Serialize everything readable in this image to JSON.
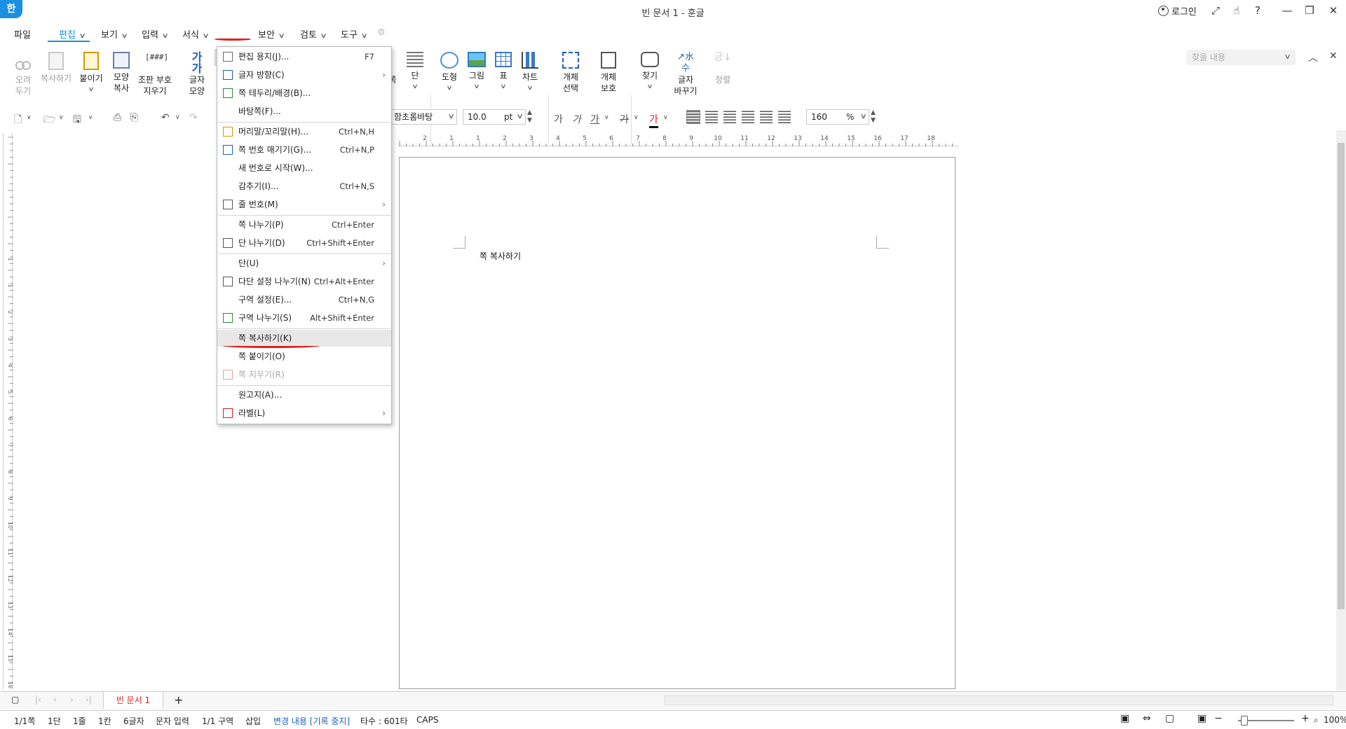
{
  "titlebar": {
    "app_logo": "한",
    "title": "빈 문서 1 - 훈글",
    "login": "로그인",
    "buttons": [
      "⤢",
      "☝",
      "?",
      "—",
      "❐",
      "✕"
    ]
  },
  "menubar": {
    "items": [
      {
        "label": "파일",
        "chev": ""
      },
      {
        "label": "편집",
        "chev": "∨"
      },
      {
        "label": "보기",
        "chev": "∨"
      },
      {
        "label": "입력",
        "chev": "∨"
      },
      {
        "label": "서식",
        "chev": "∨"
      },
      {
        "label": "쪽",
        "chev": "∨"
      },
      {
        "label": "보안",
        "chev": "∨"
      },
      {
        "label": "검토",
        "chev": "∨"
      },
      {
        "label": "도구",
        "chev": "∨"
      }
    ],
    "search_placeholder": "찾을 내용",
    "ribbon_collapse": "︿",
    "ribbon_close": "✕"
  },
  "ribbon": {
    "cut": [
      "오려",
      "두기"
    ],
    "copy": "복사하기",
    "paste": "붙이기",
    "format_copy": [
      "모양",
      "복사"
    ],
    "clear_code": [
      "조판 부호",
      "지우기"
    ],
    "clear_code_icon": "[###]",
    "char_shape": [
      "글자",
      "모양"
    ],
    "char_shape_icon": "가가",
    "col_hidden": "쪽",
    "column": "단",
    "shape": "도형",
    "image": "그림",
    "table": "표",
    "chart": "차트",
    "select_obj": [
      "개체",
      "선택"
    ],
    "protect_obj": [
      "개체",
      "보호"
    ],
    "find": "찾기",
    "replace": [
      "글자",
      "바꾸기"
    ],
    "replace_icon": "↗水 수",
    "sort": "정렬",
    "sort_icon": "긍↓",
    "chev": "∨"
  },
  "format": {
    "font_name": "함초롬바탕",
    "font_size": "10.0",
    "font_unit": "pt",
    "bold": "가",
    "italic": "가",
    "underline": "가",
    "strike": "가",
    "color": "가",
    "line_spacing": "160",
    "line_unit": "%",
    "dd": "∨"
  },
  "ruler_numbers": [
    "2",
    "1",
    "1",
    "2",
    "3",
    "4",
    "5",
    "6",
    "7",
    "8",
    "9",
    "10",
    "11",
    "12",
    "13",
    "14",
    "15",
    "16",
    "17",
    "18"
  ],
  "vruler_numbers": [
    "1",
    "1",
    "2",
    "3",
    "4",
    "5",
    "6",
    "7",
    "8",
    "9",
    "10",
    "11",
    "12",
    "13",
    "14",
    "15",
    "16"
  ],
  "page": {
    "body_text": "쪽 복사하기"
  },
  "dropdown": {
    "items": [
      {
        "label": "편집 용지(J)...",
        "shortcut": "F7",
        "arrow": "",
        "icon": "page-setup-icon",
        "disabled": false,
        "highlight": false
      },
      {
        "label": "글자 방향(C)",
        "shortcut": "",
        "arrow": "›",
        "icon": "text-direction-icon",
        "disabled": false,
        "highlight": false
      },
      {
        "label": "쪽 테두리/배경(B)...",
        "shortcut": "",
        "arrow": "",
        "icon": "page-border-icon",
        "disabled": false,
        "highlight": false
      },
      {
        "label": "바탕쪽(F)...",
        "shortcut": "",
        "arrow": "",
        "icon": "",
        "disabled": false,
        "highlight": false
      },
      {
        "label": "머리말/꼬리말(H)...",
        "shortcut": "Ctrl+N,H",
        "arrow": "",
        "icon": "header-footer-icon",
        "disabled": false,
        "highlight": false
      },
      {
        "label": "쪽 번호 매기기(G)...",
        "shortcut": "Ctrl+N,P",
        "arrow": "",
        "icon": "page-number-icon",
        "disabled": false,
        "highlight": false
      },
      {
        "label": "새 번호로 시작(W)...",
        "shortcut": "",
        "arrow": "",
        "icon": "",
        "disabled": false,
        "highlight": false
      },
      {
        "label": "감추기(I)...",
        "shortcut": "Ctrl+N,S",
        "arrow": "",
        "icon": "",
        "disabled": false,
        "highlight": false
      },
      {
        "label": "줄 번호(M)",
        "shortcut": "",
        "arrow": "›",
        "icon": "line-number-icon",
        "disabled": false,
        "highlight": false
      },
      {
        "label": "쪽 나누기(P)",
        "shortcut": "Ctrl+Enter",
        "arrow": "",
        "icon": "",
        "disabled": false,
        "highlight": false
      },
      {
        "label": "단 나누기(D)",
        "shortcut": "Ctrl+Shift+Enter",
        "arrow": "",
        "icon": "column-break-icon",
        "disabled": false,
        "highlight": false
      },
      {
        "label": "단(U)",
        "shortcut": "",
        "arrow": "›",
        "icon": "",
        "disabled": false,
        "highlight": false
      },
      {
        "label": "다단 설정 나누기(N)",
        "shortcut": "Ctrl+Alt+Enter",
        "arrow": "",
        "icon": "multi-column-icon",
        "disabled": false,
        "highlight": false
      },
      {
        "label": "구역 설정(E)...",
        "shortcut": "Ctrl+N,G",
        "arrow": "",
        "icon": "",
        "disabled": false,
        "highlight": false
      },
      {
        "label": "구역 나누기(S)",
        "shortcut": "Alt+Shift+Enter",
        "arrow": "",
        "icon": "section-break-icon",
        "disabled": false,
        "highlight": false
      },
      {
        "label": "쪽 복사하기(K)",
        "shortcut": "",
        "arrow": "",
        "icon": "",
        "disabled": false,
        "highlight": true
      },
      {
        "label": "쪽 붙이기(O)",
        "shortcut": "",
        "arrow": "",
        "icon": "",
        "disabled": false,
        "highlight": false
      },
      {
        "label": "쪽 지우기(R)",
        "shortcut": "",
        "arrow": "",
        "icon": "delete-page-icon",
        "disabled": true,
        "highlight": false
      },
      {
        "label": "원고지(A)...",
        "shortcut": "",
        "arrow": "",
        "icon": "",
        "disabled": false,
        "highlight": false
      },
      {
        "label": "라벨(L)",
        "shortcut": "",
        "arrow": "›",
        "icon": "label-icon",
        "disabled": false,
        "highlight": false
      }
    ]
  },
  "tabbar": {
    "doc_tab": "빈 문서 1",
    "add_tab": "+",
    "nav": [
      "|‹",
      "‹",
      "›",
      "›|"
    ]
  },
  "status": {
    "page": "1/1쪽",
    "column": "1단",
    "line": "1줄",
    "col_pos": "1칸",
    "chars": "6글자",
    "mode": "문자 입력",
    "section": "1/1 구역",
    "insert": "삽입",
    "track": "변경 내용 [기록 중지]",
    "typing": "타수 : 601타",
    "caps": "CAPS",
    "zoom": "100%"
  },
  "colors": {
    "accent": "#1b8fe0",
    "annotation_red": "#e01f1f",
    "doc_tab_red": "#d42020"
  }
}
